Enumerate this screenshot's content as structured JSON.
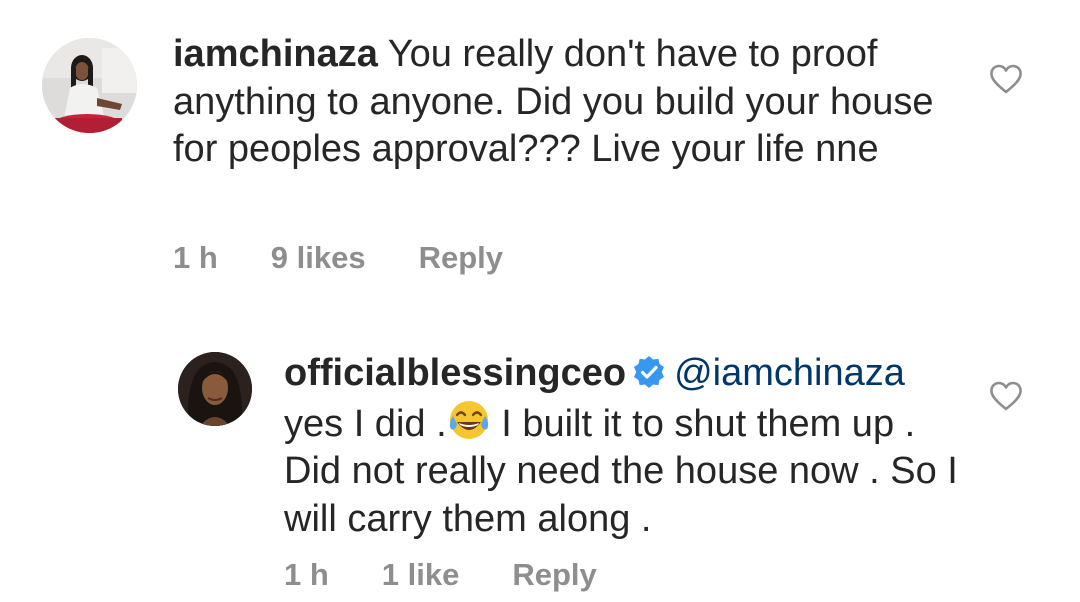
{
  "comments": [
    {
      "username": "iamchinaza",
      "text": " You really don't have to proof anything to anyone. Did you build your house for peoples approval??? Live your life nne",
      "time": "1 h",
      "likes": "9 likes",
      "reply_label": "Reply",
      "avatar_icon": "profile-photo",
      "like_icon": "heart-outline-icon"
    },
    {
      "username": "officialblessingceo",
      "verified": true,
      "mention": "@iamchinaza",
      "text_before_emoji": "yes I did .",
      "text_after_emoji": " I built it to shut them up . Did not really need the house now . So I will carry them along .",
      "emoji_icon": "face-with-tears-of-joy-emoji",
      "time": "1 h",
      "likes": "1 like",
      "reply_label": "Reply",
      "avatar_icon": "profile-photo",
      "like_icon": "heart-outline-icon"
    }
  ],
  "colors": {
    "text": "#262626",
    "meta": "#8e8e8e",
    "mention": "#00376b",
    "verified": "#3897f0"
  }
}
